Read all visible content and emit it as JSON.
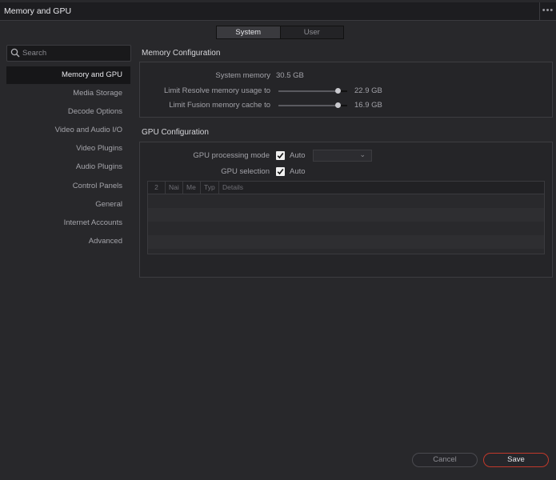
{
  "window": {
    "title": "Memory and GPU",
    "menu": "•••"
  },
  "tabs": [
    "System",
    "User"
  ],
  "search": {
    "placeholder": "Search"
  },
  "sidebar": {
    "items": [
      {
        "label": "Memory and GPU",
        "selected": true
      },
      {
        "label": "Media Storage"
      },
      {
        "label": "Decode Options"
      },
      {
        "label": "Video and Audio I/O"
      },
      {
        "label": "Video Plugins"
      },
      {
        "label": "Audio Plugins"
      },
      {
        "label": "Control Panels"
      },
      {
        "label": "General"
      },
      {
        "label": "Internet Accounts"
      },
      {
        "label": "Advanced"
      }
    ]
  },
  "memory": {
    "title": "Memory Configuration",
    "system_memory_label": "System memory",
    "system_memory_value": "30.5 GB",
    "resolve_limit_label": "Limit Resolve memory usage to",
    "resolve_limit_value": "22.9 GB",
    "resolve_limit_fraction": 0.86,
    "fusion_limit_label": "Limit Fusion memory cache to",
    "fusion_limit_value": "16.9 GB",
    "fusion_limit_fraction": 0.86
  },
  "gpu": {
    "title": "GPU Configuration",
    "processing_mode_label": "GPU processing mode",
    "processing_mode_auto": "Auto",
    "processing_mode_checked": true,
    "processing_mode_select": "",
    "selection_label": "GPU selection",
    "selection_auto": "Auto",
    "selection_checked": true,
    "table_headers": [
      "2",
      "Nai",
      "Me",
      "Typ",
      "Details"
    ]
  },
  "buttons": {
    "cancel": "Cancel",
    "save": "Save"
  },
  "colors": {
    "accent": "#c0392b",
    "selected_bg": "#161618",
    "panel_bg": "#252528"
  }
}
